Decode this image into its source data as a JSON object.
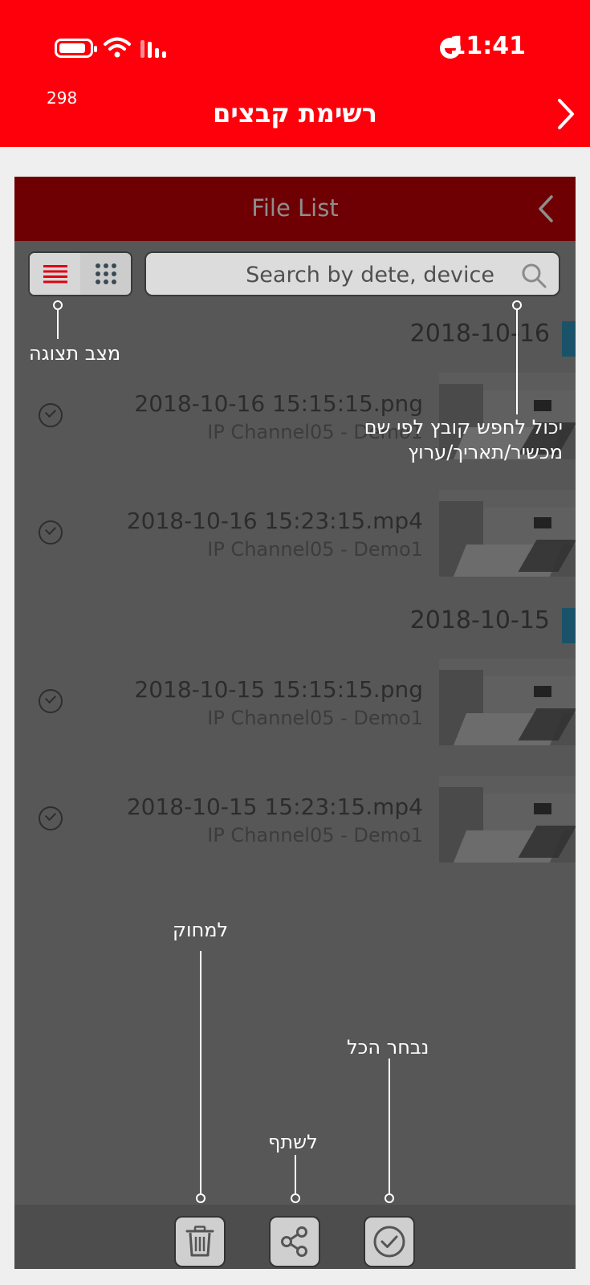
{
  "status_bar": {
    "time": "11:41"
  },
  "top_bar": {
    "counter": "298",
    "title": "רשימת קבצים"
  },
  "file_list": {
    "header_title": "File List",
    "search": {
      "placeholder": "Search by dete, device"
    },
    "groups": [
      {
        "date": "2018-10-16",
        "files": [
          {
            "name": "2018-10-16 15:15:15.png",
            "source": "IP Channel05 - Demo1"
          },
          {
            "name": "2018-10-16 15:23:15.mp4",
            "source": "IP Channel05 - Demo1"
          }
        ]
      },
      {
        "date": "2018-10-15",
        "files": [
          {
            "name": "2018-10-15 15:15:15.png",
            "source": "IP Channel05 - Demo1"
          },
          {
            "name": "2018-10-15 15:23:15.mp4",
            "source": "IP Channel05 - Demo1"
          }
        ]
      }
    ]
  },
  "annotations": {
    "view_mode": "מצב תצוגה",
    "search_hint_line1": "יכול לחפש קובץ לפי שם",
    "search_hint_line2": "מכשיר/תאריך/ערוץ",
    "delete": "למחוק",
    "select_all": "נבחר הכל",
    "share": "לשתף"
  },
  "colors": {
    "brand_red": "#fe000c",
    "header_dark_red": "#6e0003",
    "overlay": "#575757",
    "date_marker": "#1a5269"
  }
}
